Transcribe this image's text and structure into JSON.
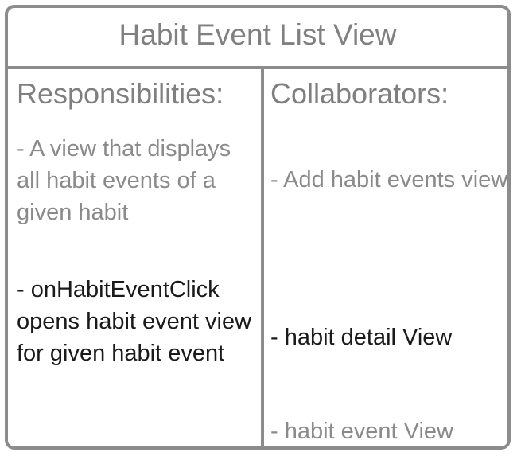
{
  "card": {
    "title": "Habit Event List View"
  },
  "responsibilities": {
    "heading": "Responsibilities:",
    "items": [
      "- A view that displays all habit events of a given habit",
      "- onHabitEventClick opens habit event view for given habit event"
    ]
  },
  "collaborators": {
    "heading": "Collaborators:",
    "items": [
      "- Add habit events view",
      "- habit detail View",
      "- habit event View"
    ]
  },
  "colors": {
    "border": "#8c8c8c",
    "muted_text": "#8a8a8a",
    "dark_text": "#1a1a1a"
  }
}
